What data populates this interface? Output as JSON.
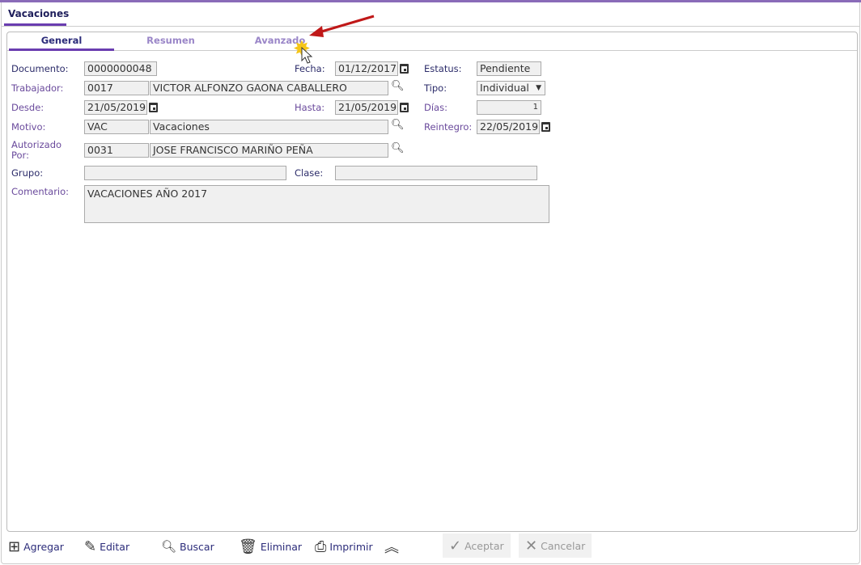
{
  "window_tab": "Vacaciones",
  "subtabs": [
    "General",
    "Resumen",
    "Avanzado"
  ],
  "form": {
    "documento_label": "Documento:",
    "documento": "0000000048",
    "fecha_label": "Fecha:",
    "fecha": "01/12/2017",
    "estatus_label": "Estatus:",
    "estatus": "Pendiente",
    "trabajador_label": "Trabajador:",
    "trabajador_code": "0017",
    "trabajador_name": "VICTOR ALFONZO GAONA CABALLERO",
    "tipo_label": "Tipo:",
    "tipo": "Individual",
    "desde_label": "Desde:",
    "desde": "21/05/2019",
    "hasta_label": "Hasta:",
    "hasta": "21/05/2019",
    "dias_label": "Días:",
    "dias": "1",
    "motivo_label": "Motivo:",
    "motivo_code": "VAC",
    "motivo_name": "Vacaciones",
    "reintegro_label": "Reintegro:",
    "reintegro": "22/05/2019",
    "autorizado_label": "Autorizado Por:",
    "autorizado_code": "0031",
    "autorizado_name": "JOSE FRANCISCO MARIÑO PEÑA",
    "grupo_label": "Grupo:",
    "grupo": "",
    "clase_label": "Clase:",
    "clase": "",
    "comentario_label": "Comentario:",
    "comentario": "VACACIONES AÑO 2017"
  },
  "toolbar": {
    "agregar": "Agregar",
    "editar": "Editar",
    "buscar": "Buscar",
    "eliminar": "Eliminar",
    "imprimir": "Imprimir",
    "aceptar": "Aceptar",
    "cancelar": "Cancelar"
  }
}
